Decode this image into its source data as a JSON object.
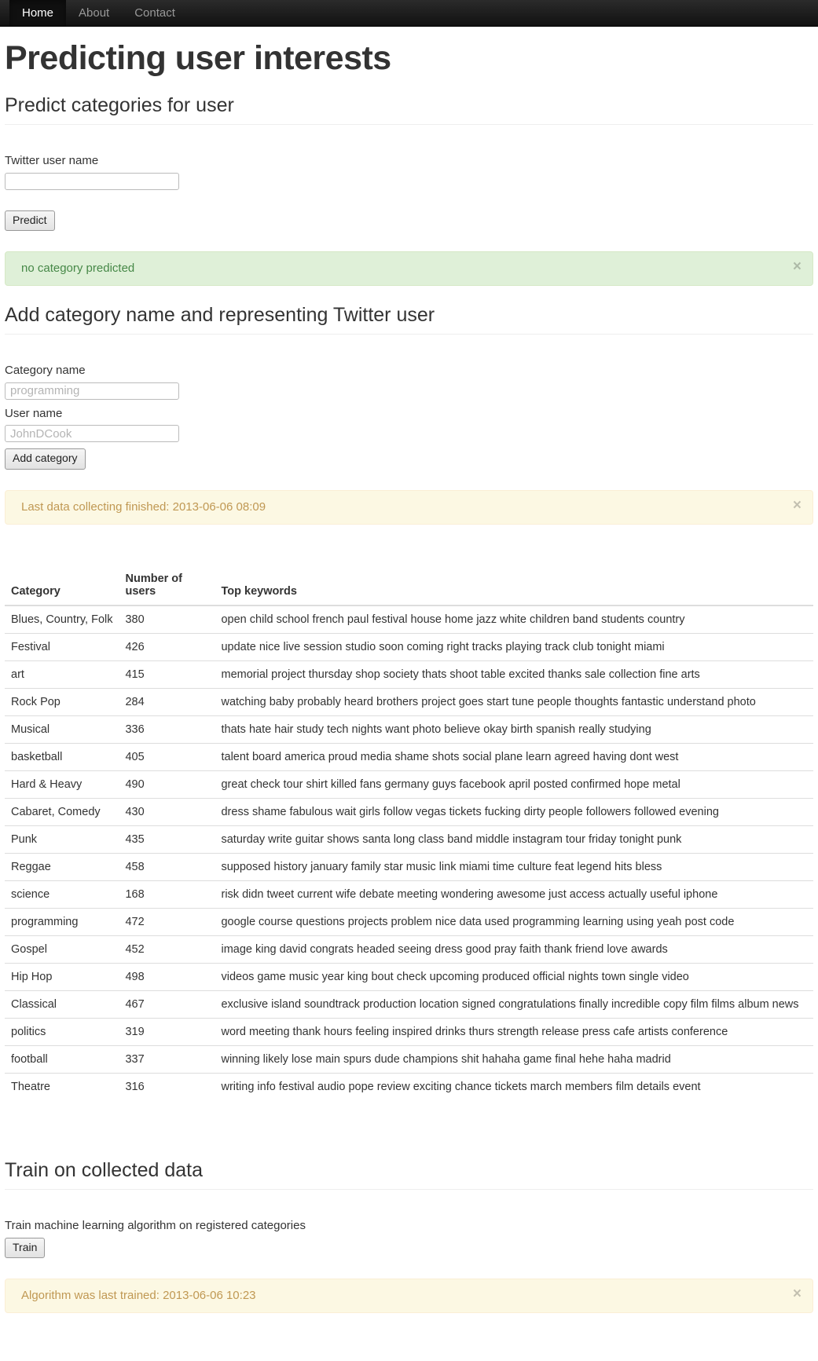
{
  "navbar": {
    "items": [
      {
        "label": "Home",
        "active": true
      },
      {
        "label": "About",
        "active": false
      },
      {
        "label": "Contact",
        "active": false
      }
    ]
  },
  "page": {
    "title": "Predicting user interests"
  },
  "predict_section": {
    "heading": "Predict categories for user",
    "username_label": "Twitter user name",
    "username_value": "",
    "username_placeholder": "",
    "predict_button": "Predict",
    "alert": {
      "text": "no category predicted",
      "close_label": "×",
      "color": "#468847",
      "background": "#dff0d8"
    }
  },
  "add_category_section": {
    "heading": "Add category name and representing Twitter user",
    "category_label": "Category name",
    "category_value": "",
    "category_placeholder": "programming",
    "user_label": "User name",
    "user_value": "",
    "user_placeholder": "JohnDCook",
    "add_button": "Add category",
    "alert": {
      "text": "Last data collecting finished: 2013-06-06 08:09",
      "close_label": "×",
      "color": "#c09853",
      "background": "#fcf8e3"
    }
  },
  "table": {
    "headers": [
      "Category",
      "Number of users",
      "Top keywords"
    ],
    "rows": [
      {
        "category": "Blues, Country, Folk",
        "users": "380",
        "keywords": "open child school french paul festival house home jazz white children band students country"
      },
      {
        "category": "Festival",
        "users": "426",
        "keywords": "update nice live session studio soon coming right tracks playing track club tonight miami"
      },
      {
        "category": "art",
        "users": "415",
        "keywords": "memorial project thursday shop society thats shoot table excited thanks sale collection fine arts"
      },
      {
        "category": "Rock Pop",
        "users": "284",
        "keywords": "watching baby probably heard brothers project goes start tune people thoughts fantastic understand photo"
      },
      {
        "category": "Musical",
        "users": "336",
        "keywords": "thats hate hair study tech nights want photo believe okay birth spanish really studying"
      },
      {
        "category": "basketball",
        "users": "405",
        "keywords": "talent board america proud media shame shots social plane learn agreed having dont west"
      },
      {
        "category": "Hard & Heavy",
        "users": "490",
        "keywords": "great check tour shirt killed fans germany guys facebook april posted confirmed hope metal"
      },
      {
        "category": "Cabaret, Comedy",
        "users": "430",
        "keywords": "dress shame fabulous wait girls follow vegas tickets fucking dirty people followers followed evening"
      },
      {
        "category": "Punk",
        "users": "435",
        "keywords": "saturday write guitar shows santa long class band middle instagram tour friday tonight punk"
      },
      {
        "category": "Reggae",
        "users": "458",
        "keywords": "supposed history january family star music link miami time culture feat legend hits bless"
      },
      {
        "category": "science",
        "users": "168",
        "keywords": "risk didn tweet current wife debate meeting wondering awesome just access actually useful iphone"
      },
      {
        "category": "programming",
        "users": "472",
        "keywords": "google course questions projects problem nice data used programming learning using yeah post code"
      },
      {
        "category": "Gospel",
        "users": "452",
        "keywords": "image king david congrats headed seeing dress good pray faith thank friend love awards"
      },
      {
        "category": "Hip Hop",
        "users": "498",
        "keywords": "videos game music year king bout check upcoming produced official nights town single video"
      },
      {
        "category": "Classical",
        "users": "467",
        "keywords": "exclusive island soundtrack production location signed congratulations finally incredible copy film films album news"
      },
      {
        "category": "politics",
        "users": "319",
        "keywords": "word meeting thank hours feeling inspired drinks thurs strength release press cafe artists conference"
      },
      {
        "category": "football",
        "users": "337",
        "keywords": "winning likely lose main spurs dude champions shit hahaha game final hehe haha madrid"
      },
      {
        "category": "Theatre",
        "users": "316",
        "keywords": "writing info festival audio pope review exciting chance tickets march members film details event"
      }
    ]
  },
  "train_section": {
    "heading": "Train on collected data",
    "description": "Train machine learning algorithm on registered categories",
    "train_button": "Train",
    "alert": {
      "text": "Algorithm was last trained: 2013-06-06 10:23",
      "close_label": "×",
      "color": "#c09853",
      "background": "#fcf8e3"
    }
  }
}
